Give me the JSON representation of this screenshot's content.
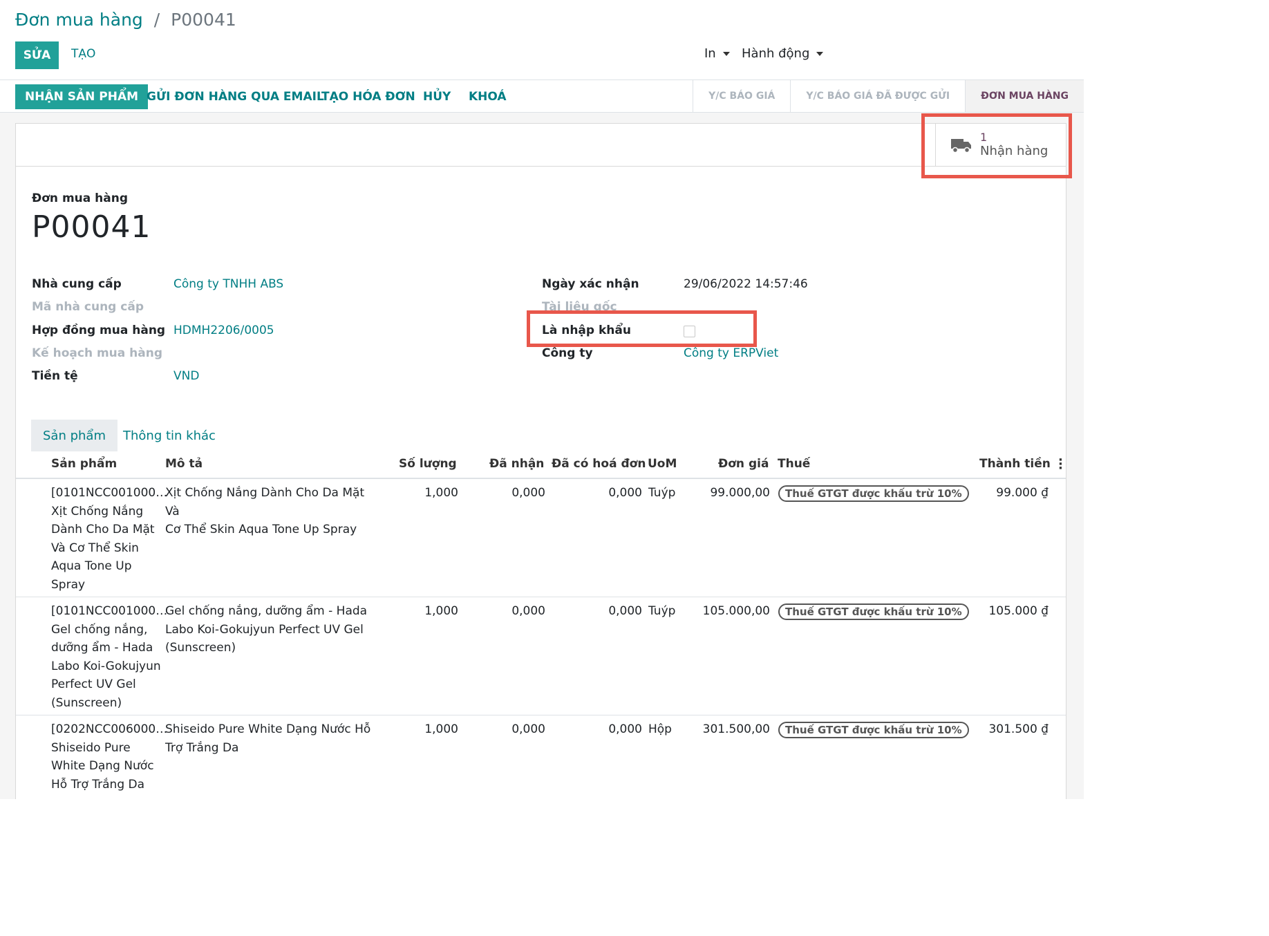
{
  "breadcrumb": {
    "parent": "Đơn mua hàng",
    "separator": "/",
    "current": "P00041"
  },
  "toolbar": {
    "edit_label": "SỬA",
    "create_label": "TẠO",
    "print_label": "In",
    "action_label": "Hành động"
  },
  "statusbar": {
    "buttons": [
      "NHẬN SẢN PHẨM",
      "GỬI ĐƠN HÀNG QUA EMAIL",
      "TẠO HÓA ĐƠN",
      "HỦY",
      "KHOÁ"
    ],
    "stages": [
      "Y/C BÁO GIÁ",
      "Y/C BÁO GIÁ ĐÃ ĐƯỢC GỬI",
      "ĐƠN MUA HÀNG"
    ],
    "active_stage": "ĐƠN MUA HÀNG"
  },
  "smart_button": {
    "count": "1",
    "label": "Nhận hàng",
    "icon": "truck-icon"
  },
  "form": {
    "doc_label": "Đơn mua hàng",
    "doc_name": "P00041",
    "left_fields": [
      {
        "label": "Nhà cung cấp",
        "value": "Công ty TNHH ABS"
      },
      {
        "label": "Mã nhà cung cấp",
        "value": ""
      },
      {
        "label": "Hợp đồng mua hàng",
        "value": "HDMH2206/0005"
      },
      {
        "label": "Kế hoạch mua hàng",
        "value": ""
      },
      {
        "label": "Tiền tệ",
        "value": "VND"
      }
    ],
    "right_fields": [
      {
        "label": "Ngày xác nhận",
        "value": "29/06/2022 14:57:46"
      },
      {
        "label": "Tài liệu gốc",
        "value": ""
      },
      {
        "label": "Là nhập khẩu",
        "value": false
      },
      {
        "label": "Công ty",
        "value": "Công ty ERPViet"
      }
    ]
  },
  "tabs": [
    "Sản phẩm",
    "Thông tin khác"
  ],
  "table": {
    "headers": [
      "Sản phẩm",
      "Mô tả",
      "Số lượng",
      "Đã nhận",
      "Đã có hoá đơn",
      "UoM",
      "Đơn giá",
      "Thuế",
      "Thành tiền"
    ],
    "rows": [
      {
        "product": [
          "[0101NCC001000…",
          "Xịt Chống Nắng",
          "Dành Cho Da Mặt",
          "Và Cơ Thể Skin",
          "Aqua Tone Up",
          "Spray"
        ],
        "description": [
          "Xịt Chống Nắng Dành Cho Da Mặt Và",
          "Cơ Thể Skin Aqua Tone Up Spray"
        ],
        "qty": "1,000",
        "received": "0,000",
        "invoiced": "0,000",
        "uom": "Tuýp",
        "price": "99.000,00",
        "tax": "Thuế GTGT được khấu trừ 10%",
        "subtotal": "99.000 ₫"
      },
      {
        "product": [
          "[0101NCC001000…",
          "Gel chống nắng,",
          "dưỡng ẩm - Hada",
          "Labo Koi-Gokujyun",
          "Perfect UV Gel",
          "(Sunscreen)"
        ],
        "description": [
          "Gel chống nắng, dưỡng ẩm - Hada",
          "Labo Koi-Gokujyun Perfect UV Gel",
          "(Sunscreen)"
        ],
        "qty": "1,000",
        "received": "0,000",
        "invoiced": "0,000",
        "uom": "Tuýp",
        "price": "105.000,00",
        "tax": "Thuế GTGT được khấu trừ 10%",
        "subtotal": "105.000 ₫"
      },
      {
        "product": [
          "[0202NCC006000…",
          "Shiseido Pure",
          "White Dạng Nước",
          "Hỗ Trợ Trắng Da"
        ],
        "description": [
          "Shiseido Pure White Dạng Nước Hỗ",
          "Trợ Trắng Da"
        ],
        "qty": "1,000",
        "received": "0,000",
        "invoiced": "0,000",
        "uom": "Hộp",
        "price": "301.500,00",
        "tax": "Thuế GTGT được khấu trừ 10%",
        "subtotal": "301.500 ₫"
      }
    ]
  },
  "colors": {
    "primary": "#21a199",
    "link": "#017e84",
    "highlight": "#e8574b",
    "active_stage": "#6b4462"
  }
}
